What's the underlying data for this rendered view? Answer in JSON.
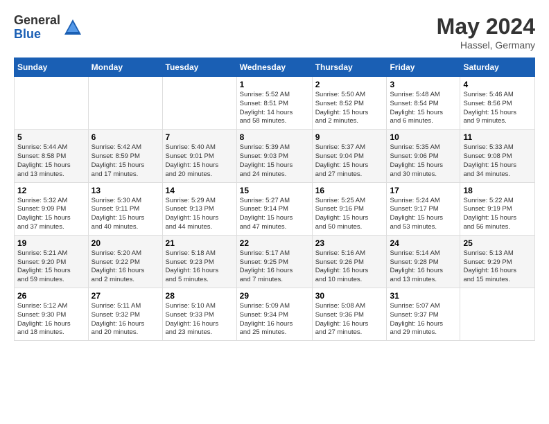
{
  "header": {
    "logo_general": "General",
    "logo_blue": "Blue",
    "month_year": "May 2024",
    "location": "Hassel, Germany"
  },
  "days_of_week": [
    "Sunday",
    "Monday",
    "Tuesday",
    "Wednesday",
    "Thursday",
    "Friday",
    "Saturday"
  ],
  "weeks": [
    [
      {
        "day": "",
        "info": ""
      },
      {
        "day": "",
        "info": ""
      },
      {
        "day": "",
        "info": ""
      },
      {
        "day": "1",
        "info": "Sunrise: 5:52 AM\nSunset: 8:51 PM\nDaylight: 14 hours\nand 58 minutes."
      },
      {
        "day": "2",
        "info": "Sunrise: 5:50 AM\nSunset: 8:52 PM\nDaylight: 15 hours\nand 2 minutes."
      },
      {
        "day": "3",
        "info": "Sunrise: 5:48 AM\nSunset: 8:54 PM\nDaylight: 15 hours\nand 6 minutes."
      },
      {
        "day": "4",
        "info": "Sunrise: 5:46 AM\nSunset: 8:56 PM\nDaylight: 15 hours\nand 9 minutes."
      }
    ],
    [
      {
        "day": "5",
        "info": "Sunrise: 5:44 AM\nSunset: 8:58 PM\nDaylight: 15 hours\nand 13 minutes."
      },
      {
        "day": "6",
        "info": "Sunrise: 5:42 AM\nSunset: 8:59 PM\nDaylight: 15 hours\nand 17 minutes."
      },
      {
        "day": "7",
        "info": "Sunrise: 5:40 AM\nSunset: 9:01 PM\nDaylight: 15 hours\nand 20 minutes."
      },
      {
        "day": "8",
        "info": "Sunrise: 5:39 AM\nSunset: 9:03 PM\nDaylight: 15 hours\nand 24 minutes."
      },
      {
        "day": "9",
        "info": "Sunrise: 5:37 AM\nSunset: 9:04 PM\nDaylight: 15 hours\nand 27 minutes."
      },
      {
        "day": "10",
        "info": "Sunrise: 5:35 AM\nSunset: 9:06 PM\nDaylight: 15 hours\nand 30 minutes."
      },
      {
        "day": "11",
        "info": "Sunrise: 5:33 AM\nSunset: 9:08 PM\nDaylight: 15 hours\nand 34 minutes."
      }
    ],
    [
      {
        "day": "12",
        "info": "Sunrise: 5:32 AM\nSunset: 9:09 PM\nDaylight: 15 hours\nand 37 minutes."
      },
      {
        "day": "13",
        "info": "Sunrise: 5:30 AM\nSunset: 9:11 PM\nDaylight: 15 hours\nand 40 minutes."
      },
      {
        "day": "14",
        "info": "Sunrise: 5:29 AM\nSunset: 9:13 PM\nDaylight: 15 hours\nand 44 minutes."
      },
      {
        "day": "15",
        "info": "Sunrise: 5:27 AM\nSunset: 9:14 PM\nDaylight: 15 hours\nand 47 minutes."
      },
      {
        "day": "16",
        "info": "Sunrise: 5:25 AM\nSunset: 9:16 PM\nDaylight: 15 hours\nand 50 minutes."
      },
      {
        "day": "17",
        "info": "Sunrise: 5:24 AM\nSunset: 9:17 PM\nDaylight: 15 hours\nand 53 minutes."
      },
      {
        "day": "18",
        "info": "Sunrise: 5:22 AM\nSunset: 9:19 PM\nDaylight: 15 hours\nand 56 minutes."
      }
    ],
    [
      {
        "day": "19",
        "info": "Sunrise: 5:21 AM\nSunset: 9:20 PM\nDaylight: 15 hours\nand 59 minutes."
      },
      {
        "day": "20",
        "info": "Sunrise: 5:20 AM\nSunset: 9:22 PM\nDaylight: 16 hours\nand 2 minutes."
      },
      {
        "day": "21",
        "info": "Sunrise: 5:18 AM\nSunset: 9:23 PM\nDaylight: 16 hours\nand 5 minutes."
      },
      {
        "day": "22",
        "info": "Sunrise: 5:17 AM\nSunset: 9:25 PM\nDaylight: 16 hours\nand 7 minutes."
      },
      {
        "day": "23",
        "info": "Sunrise: 5:16 AM\nSunset: 9:26 PM\nDaylight: 16 hours\nand 10 minutes."
      },
      {
        "day": "24",
        "info": "Sunrise: 5:14 AM\nSunset: 9:28 PM\nDaylight: 16 hours\nand 13 minutes."
      },
      {
        "day": "25",
        "info": "Sunrise: 5:13 AM\nSunset: 9:29 PM\nDaylight: 16 hours\nand 15 minutes."
      }
    ],
    [
      {
        "day": "26",
        "info": "Sunrise: 5:12 AM\nSunset: 9:30 PM\nDaylight: 16 hours\nand 18 minutes."
      },
      {
        "day": "27",
        "info": "Sunrise: 5:11 AM\nSunset: 9:32 PM\nDaylight: 16 hours\nand 20 minutes."
      },
      {
        "day": "28",
        "info": "Sunrise: 5:10 AM\nSunset: 9:33 PM\nDaylight: 16 hours\nand 23 minutes."
      },
      {
        "day": "29",
        "info": "Sunrise: 5:09 AM\nSunset: 9:34 PM\nDaylight: 16 hours\nand 25 minutes."
      },
      {
        "day": "30",
        "info": "Sunrise: 5:08 AM\nSunset: 9:36 PM\nDaylight: 16 hours\nand 27 minutes."
      },
      {
        "day": "31",
        "info": "Sunrise: 5:07 AM\nSunset: 9:37 PM\nDaylight: 16 hours\nand 29 minutes."
      },
      {
        "day": "",
        "info": ""
      }
    ]
  ]
}
